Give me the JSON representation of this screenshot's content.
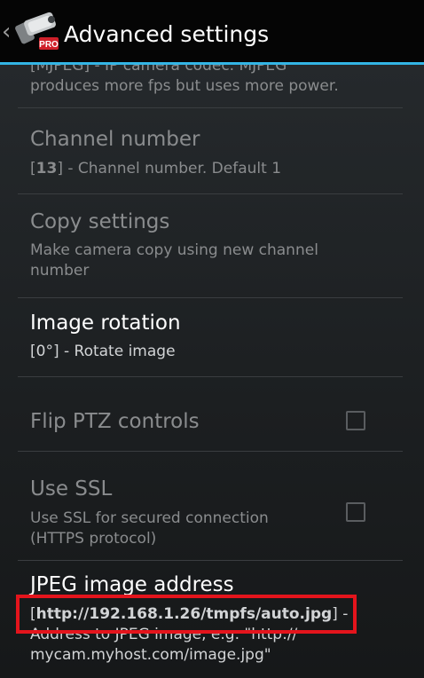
{
  "action_bar": {
    "title": "Advanced settings",
    "up_caret": "‹",
    "icon": "security-camera-pro-icon",
    "icon_badge": "PRO",
    "accent_color": "#33b5e5"
  },
  "preferences": {
    "codec": {
      "summary_line1": "[MJPEG] - IP camera codec. MJPEG",
      "summary_line2": "produces more fps but uses more power."
    },
    "channel_number": {
      "title": "Channel number",
      "value": "13",
      "summary_rest": "] - Channel number. Default 1"
    },
    "copy_settings": {
      "title": "Copy settings",
      "summary_line1": "Make camera copy using new channel",
      "summary_line2": "number"
    },
    "image_rotation": {
      "title": "Image rotation",
      "summary": "[0°] - Rotate image"
    },
    "flip_ptz": {
      "title": "Flip PTZ controls",
      "checked": false
    },
    "use_ssl": {
      "title": "Use SSL",
      "summary_line1": "Use SSL for secured connection",
      "summary_line2": "(HTTPS protocol)",
      "checked": false
    },
    "jpeg_address": {
      "title": "JPEG image address",
      "value": "http://192.168.1.26/tmpfs/auto.jpg",
      "summary_suffix": "] -",
      "summary_line2": "Address to JPEG image, e.g. \"http://",
      "summary_line3": "mycam.myhost.com/image.jpg\""
    }
  },
  "colors": {
    "highlight_box": "#e4141c",
    "divider": "#3a3d40"
  }
}
